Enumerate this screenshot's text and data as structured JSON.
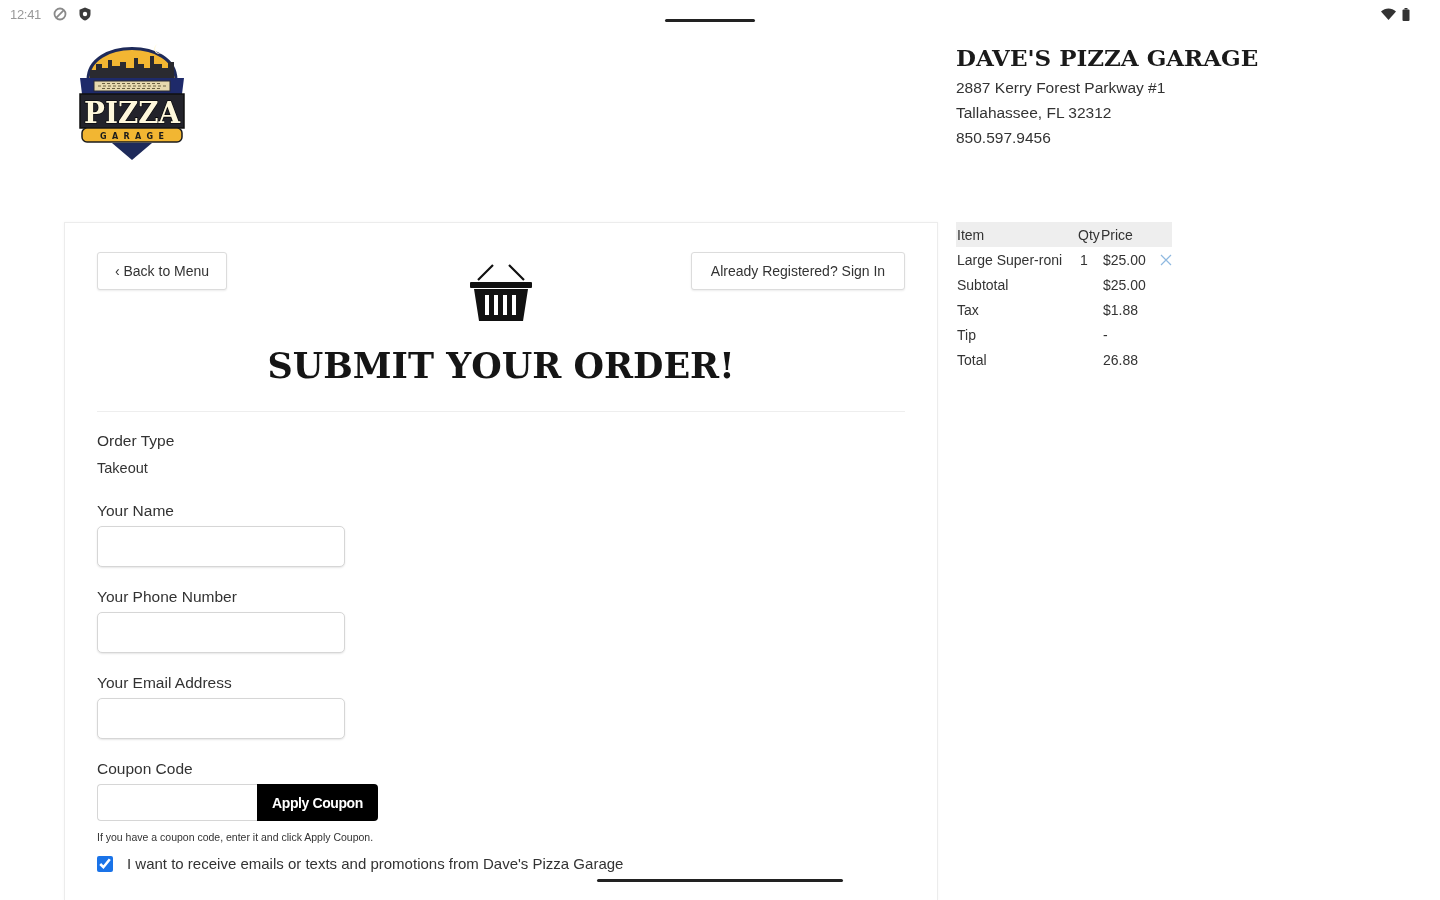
{
  "status_bar": {
    "time": "12:41"
  },
  "header": {
    "logo": {
      "words": [
        "PIZZA",
        "GARAGE"
      ]
    },
    "name": "DAVE'S PIZZA GARAGE",
    "address_lines": [
      "2887 Kerry Forest Parkway #1",
      "Tallahassee, FL 32312",
      "850.597.9456"
    ]
  },
  "order_form": {
    "back_button": "‹ Back to Menu",
    "sign_in_button": "Already Registered? Sign In",
    "title": "SUBMIT YOUR ORDER!",
    "order_type": {
      "label": "Order Type",
      "value": "Takeout"
    },
    "fields": [
      {
        "label": "Your Name"
      },
      {
        "label": "Your Phone Number"
      },
      {
        "label": "Your Email Address"
      }
    ],
    "coupon": {
      "label": "Coupon Code",
      "button": "Apply Coupon",
      "help": "If you have a coupon code, enter it and click Apply Coupon."
    },
    "promotions": {
      "label": "I want to receive emails or texts and promotions from Dave's Pizza Garage",
      "checked": true
    }
  },
  "order_summary": {
    "columns": [
      "Item",
      "Qty",
      "Price"
    ],
    "items": [
      {
        "item": "Large Super-roni",
        "qty": "1",
        "price": "$25.00"
      }
    ],
    "totals": [
      {
        "label": "Subtotal",
        "value": "$25.00"
      },
      {
        "label": "Tax",
        "value": "$1.88"
      },
      {
        "label": "Tip",
        "value": "-"
      },
      {
        "label": "Total",
        "value": "26.88"
      }
    ]
  }
}
